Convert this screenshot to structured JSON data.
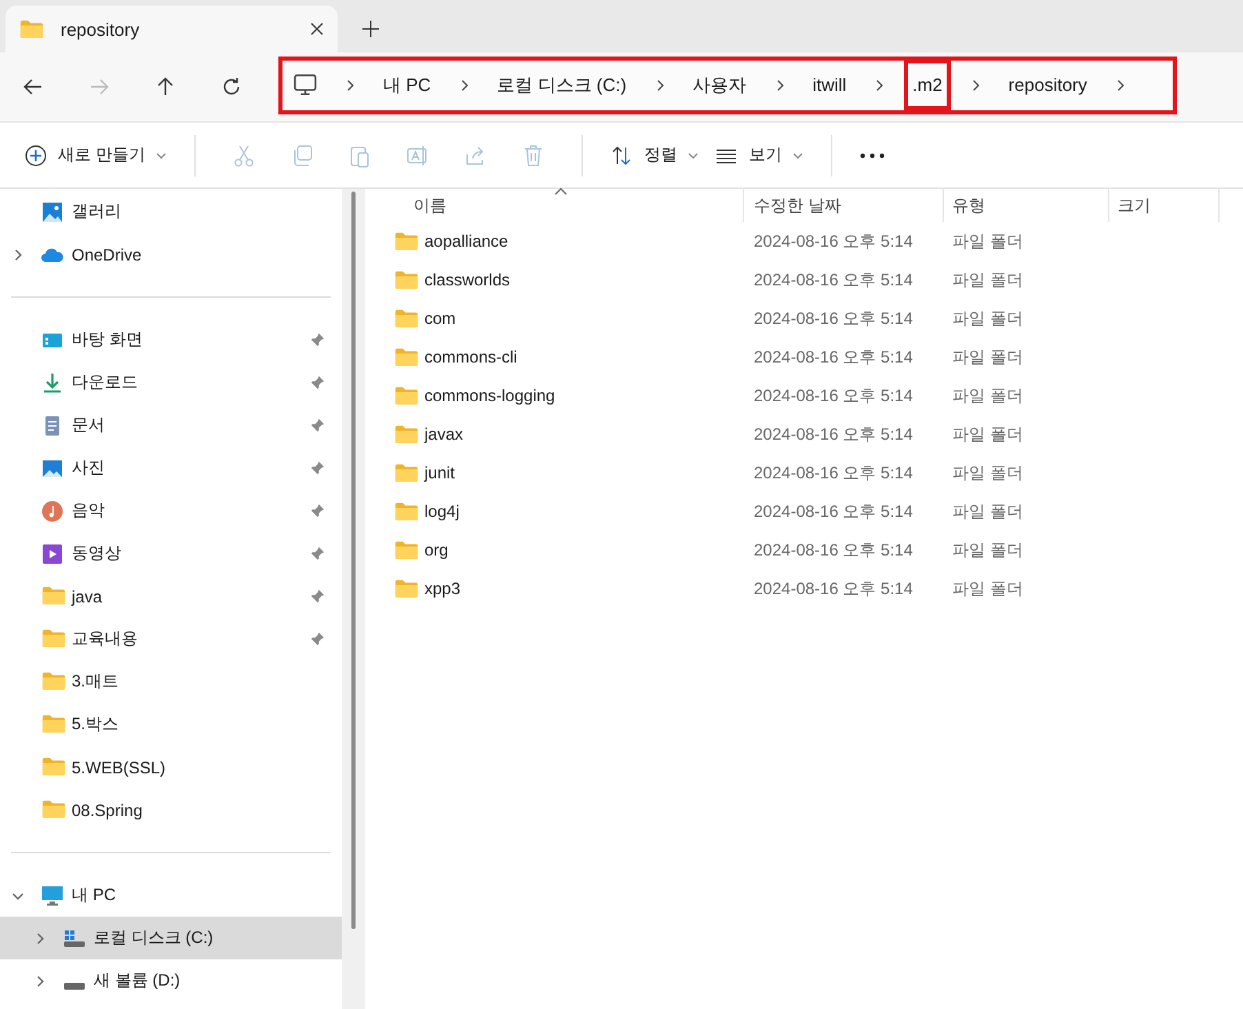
{
  "tab": {
    "title": "repository",
    "selected": true
  },
  "nav": [
    {
      "kind": "back",
      "disabled": false
    },
    {
      "kind": "forward",
      "disabled": true
    },
    {
      "kind": "up",
      "disabled": false
    },
    {
      "kind": "refresh",
      "disabled": false
    }
  ],
  "address_bar": {
    "highlighted": true,
    "crumbs": [
      {
        "label": "내 PC",
        "highlighted": false
      },
      {
        "label": "로컬 디스크 (C:)",
        "highlighted": false
      },
      {
        "label": "사용자",
        "highlighted": false
      },
      {
        "label": "itwill",
        "highlighted": false
      },
      {
        "label": ".m2",
        "highlighted": true
      },
      {
        "label": "repository",
        "highlighted": false
      }
    ]
  },
  "toolbar": {
    "new_label": "새로 만들기",
    "actions": [
      {
        "kind": "cut",
        "disabled": true
      },
      {
        "kind": "copy",
        "disabled": true
      },
      {
        "kind": "paste",
        "disabled": true
      },
      {
        "kind": "rename",
        "disabled": true
      },
      {
        "kind": "share",
        "disabled": true
      },
      {
        "kind": "delete",
        "disabled": true
      }
    ],
    "sort_label": "정렬",
    "view_label": "보기"
  },
  "sidebar": {
    "sections": [
      [
        {
          "label": "갤러리",
          "kind": "gallery",
          "selected": false
        },
        {
          "label": "OneDrive",
          "kind": "cloud",
          "selected": false,
          "expanded": false
        }
      ],
      [
        {
          "label": "바탕 화면",
          "kind": "desktop",
          "pinned": true,
          "selected": false
        },
        {
          "label": "다운로드",
          "kind": "download",
          "pinned": true,
          "selected": false
        },
        {
          "label": "문서",
          "kind": "document",
          "pinned": true,
          "selected": false
        },
        {
          "label": "사진",
          "kind": "picture",
          "pinned": true,
          "selected": false
        },
        {
          "label": "음악",
          "kind": "music",
          "pinned": true,
          "selected": false
        },
        {
          "label": "동영상",
          "kind": "video",
          "pinned": true,
          "selected": false
        },
        {
          "label": "java",
          "kind": "folder",
          "pinned": true,
          "selected": false
        },
        {
          "label": "교육내용",
          "kind": "folder",
          "pinned": true,
          "selected": false
        },
        {
          "label": "3.매트",
          "kind": "folder",
          "pinned": false,
          "selected": false
        },
        {
          "label": "5.박스",
          "kind": "folder",
          "pinned": false,
          "selected": false
        },
        {
          "label": "5.WEB(SSL)",
          "kind": "folder",
          "pinned": false,
          "selected": false
        },
        {
          "label": "08.Spring",
          "kind": "folder",
          "pinned": false,
          "selected": false
        }
      ],
      [
        {
          "label": "내 PC",
          "kind": "pc",
          "selected": false,
          "expanded": true,
          "children": [
            {
              "label": "로컬 디스크 (C:)",
              "kind": "system-drive",
              "selected": true,
              "expanded": false
            },
            {
              "label": "새 볼륨 (D:)",
              "kind": "drive",
              "selected": false,
              "expanded": false
            }
          ]
        }
      ]
    ]
  },
  "table": {
    "columns": [
      {
        "label": "이름",
        "sorted": true
      },
      {
        "label": "수정한 날짜",
        "sorted": false
      },
      {
        "label": "유형",
        "sorted": false
      },
      {
        "label": "크기",
        "sorted": false
      }
    ],
    "rows": [
      {
        "name": "aopalliance",
        "date": "2024-08-16 오후 5:14",
        "type": "파일 폴더"
      },
      {
        "name": "classworlds",
        "date": "2024-08-16 오후 5:14",
        "type": "파일 폴더"
      },
      {
        "name": "com",
        "date": "2024-08-16 오후 5:14",
        "type": "파일 폴더"
      },
      {
        "name": "commons-cli",
        "date": "2024-08-16 오후 5:14",
        "type": "파일 폴더"
      },
      {
        "name": "commons-logging",
        "date": "2024-08-16 오후 5:14",
        "type": "파일 폴더"
      },
      {
        "name": "javax",
        "date": "2024-08-16 오후 5:14",
        "type": "파일 폴더"
      },
      {
        "name": "junit",
        "date": "2024-08-16 오후 5:14",
        "type": "파일 폴더"
      },
      {
        "name": "log4j",
        "date": "2024-08-16 오후 5:14",
        "type": "파일 폴더"
      },
      {
        "name": "org",
        "date": "2024-08-16 오후 5:14",
        "type": "파일 폴더"
      },
      {
        "name": "xpp3",
        "date": "2024-08-16 오후 5:14",
        "type": "파일 폴더"
      }
    ]
  }
}
